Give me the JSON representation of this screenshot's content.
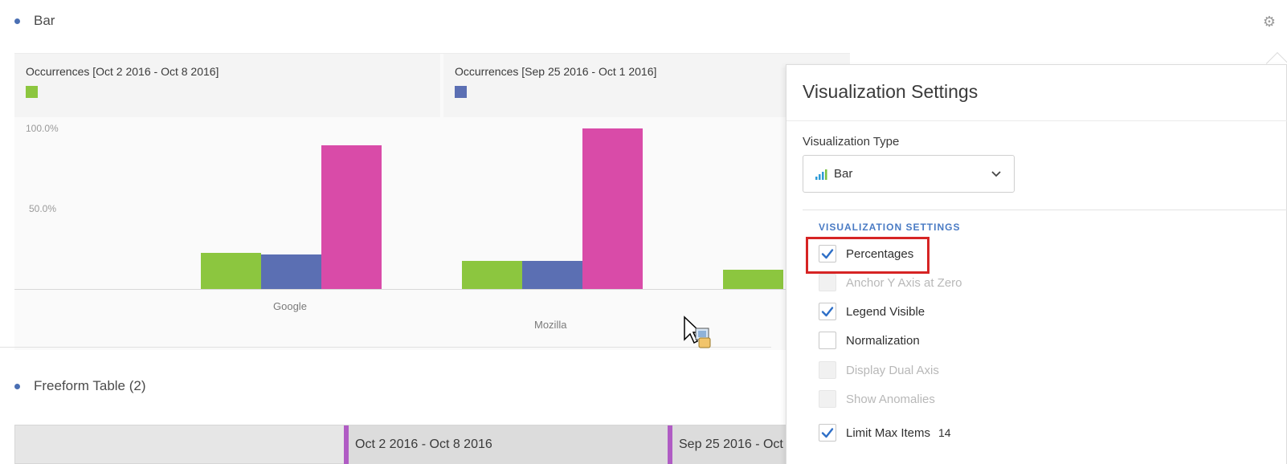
{
  "panel": {
    "title": "Bar"
  },
  "chart_data": {
    "type": "bar",
    "categories": [
      "Google",
      "Mozilla",
      ""
    ],
    "series": [
      {
        "name": "Occurrences [Oct 2 2016 - Oct 8 2016]",
        "color": "#8cc63f",
        "values": [
          22.5,
          17.5,
          12
        ]
      },
      {
        "name": "Occurrences [Sep 25 2016 - Oct 1 2016]",
        "color": "#5b6fb3",
        "values": [
          21.5,
          17.5,
          null
        ]
      },
      {
        "name": "",
        "color": "#d94ba8",
        "values": [
          89.5,
          100,
          null
        ]
      }
    ],
    "ytick_labels": [
      "100.0%",
      "50.0%"
    ],
    "ylim": [
      0,
      100
    ],
    "legend": "top"
  },
  "table_panel": {
    "title": "Freeform Table (2)",
    "columns": [
      "Oct 2 2016 - Oct 8 2016",
      "Sep 25 2016 - Oct"
    ]
  },
  "settings": {
    "title": "Visualization Settings",
    "type_label": "Visualization Type",
    "type_value": "Bar",
    "section": "VISUALIZATION SETTINGS",
    "options": [
      {
        "label": "Percentages",
        "checked": true,
        "disabled": false
      },
      {
        "label": "Anchor Y Axis at Zero",
        "checked": false,
        "disabled": true
      },
      {
        "label": "Legend Visible",
        "checked": true,
        "disabled": false
      },
      {
        "label": "Normalization",
        "checked": false,
        "disabled": false
      },
      {
        "label": "Display Dual Axis",
        "checked": false,
        "disabled": true
      },
      {
        "label": "Show Anomalies",
        "checked": false,
        "disabled": true
      },
      {
        "label": "Limit Max Items",
        "checked": true,
        "disabled": false
      }
    ],
    "max_items": "14"
  }
}
